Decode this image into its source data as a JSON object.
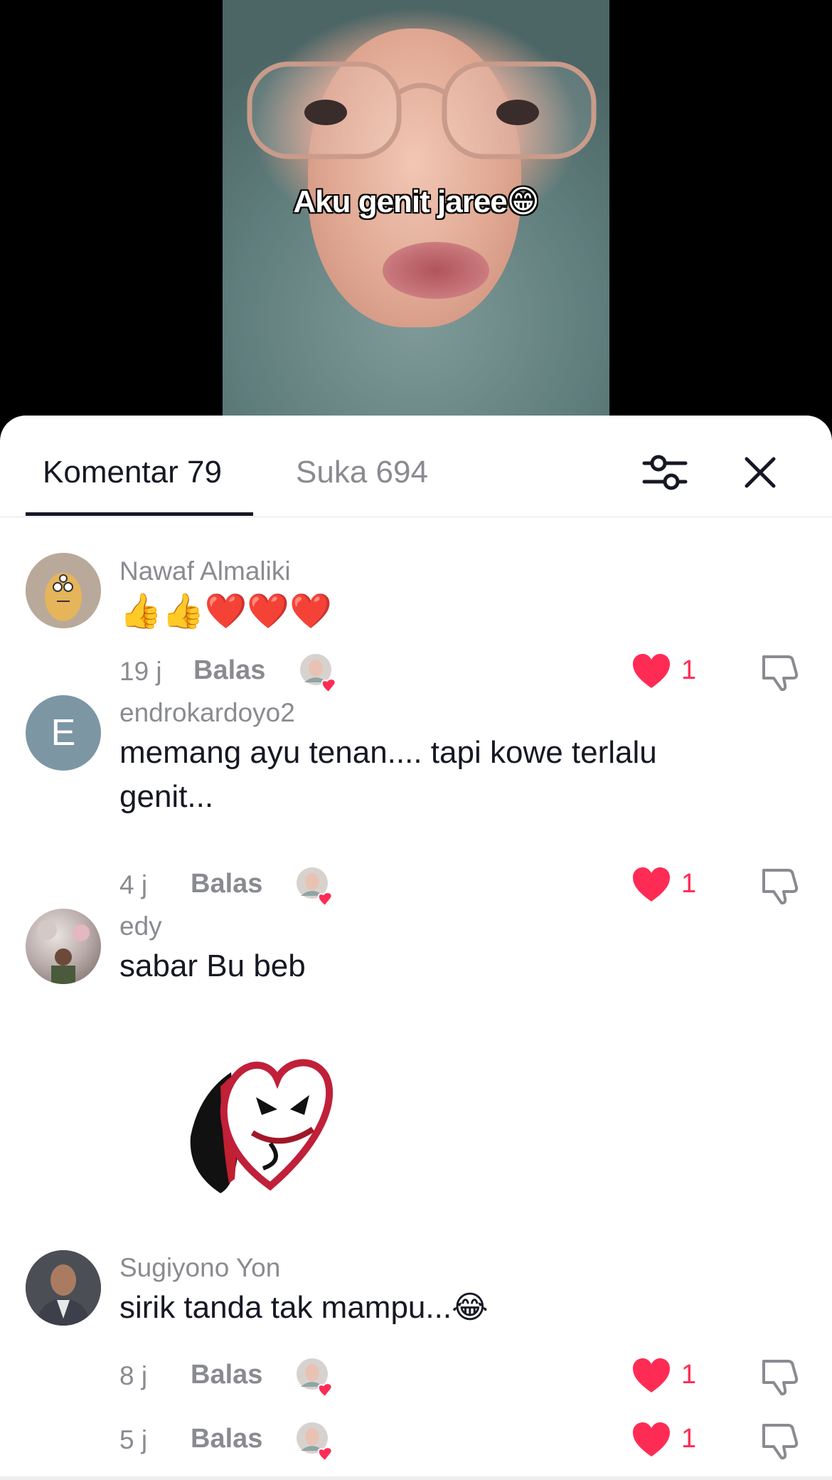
{
  "video": {
    "caption": "Aku genit jaree😁"
  },
  "tabs": {
    "comments_label": "Komentar 79",
    "likes_label": "Suka 694"
  },
  "comments": [
    {
      "username": "Nawaf Almaliki",
      "text": "👍👍❤️❤️❤️",
      "time": "19 j",
      "reply_label": "Balas",
      "likes": "1",
      "avatar_icon": "cartoon-avatar-icon"
    },
    {
      "username": "endrokardoyo2",
      "text": "memang ayu tenan.... tapi kowe terlalu genit...",
      "time": "4 j",
      "reply_label": "Balas",
      "likes": "1",
      "avatar_letter": "E"
    },
    {
      "username": "edy",
      "text": "sabar Bu beb",
      "time": "5 j",
      "reply_label": "Balas",
      "likes": "1",
      "sticker_icon": "joker-heart-sticker-icon"
    },
    {
      "username": "Sugiyono Yon",
      "text": "sirik tanda tak mampu...😂",
      "time": "8 j",
      "reply_label": "Balas",
      "likes": "1"
    }
  ],
  "colors": {
    "like": "#fe2c55",
    "text_primary": "#161823",
    "text_secondary": "#8a8b91"
  }
}
